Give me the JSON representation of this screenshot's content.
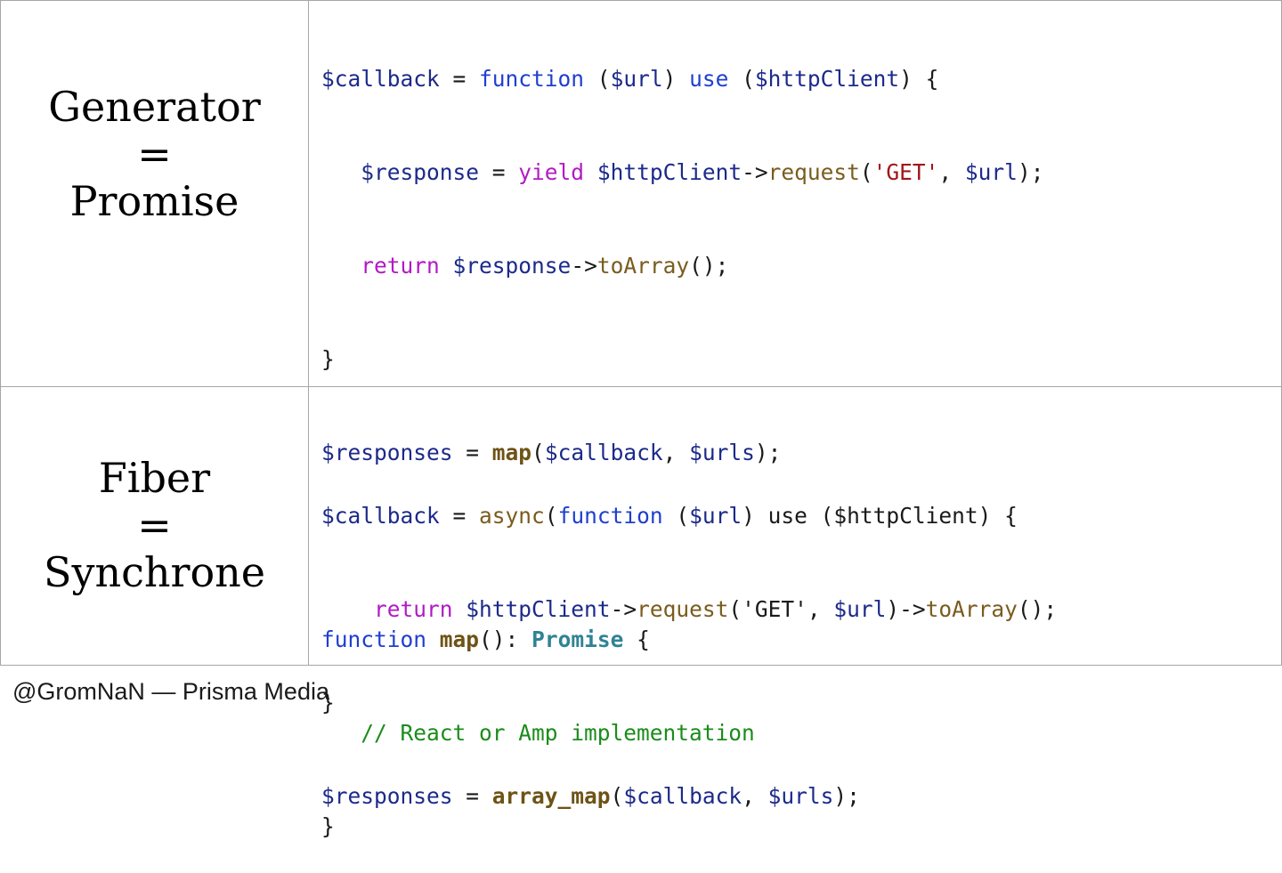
{
  "rows": [
    {
      "label_lines": [
        "Generator",
        "=",
        "Promise"
      ]
    },
    {
      "label_lines": [
        "Fiber",
        "=",
        "Synchrone"
      ]
    }
  ],
  "code_top": {
    "l1": {
      "a": "$callback",
      "b": " = ",
      "c": "function",
      "d": " (",
      "e": "$url",
      "f": ") ",
      "g": "use",
      "h": " (",
      "i": "$httpClient",
      "j": ") {"
    },
    "l2": {
      "indent": "   ",
      "a": "$response",
      "b": " = ",
      "c": "yield",
      "d": " ",
      "e": "$httpClient",
      "f": "->",
      "g": "request",
      "h": "(",
      "i": "'GET'",
      "j": ", ",
      "k": "$url",
      "l": ");"
    },
    "l3": {
      "indent": "   ",
      "a": "return",
      "b": " ",
      "c": "$response",
      "d": "->",
      "e": "toArray",
      "f": "();"
    },
    "l4": {
      "a": "}"
    },
    "l5": {
      "a": "$responses",
      "b": " = ",
      "c": "map",
      "d": "(",
      "e": "$callback",
      "f": ", ",
      "g": "$urls",
      "h": ");"
    },
    "l6": {
      "a": ""
    },
    "l7": {
      "a": "function",
      "b": " ",
      "c": "map",
      "d": "(): ",
      "e": "Promise",
      "f": " {"
    },
    "l8": {
      "indent": "   ",
      "a": "// React or Amp implementation"
    },
    "l9": {
      "a": "}"
    }
  },
  "code_bot": {
    "l1": {
      "a": "$callback",
      "b": " = ",
      "c": "async",
      "d": "(",
      "e": "function",
      "f": " (",
      "g": "$url",
      "h": ") use (",
      "i": "$httpClient",
      "j": ") {"
    },
    "l2": {
      "indent": "    ",
      "a": "return",
      "b": " ",
      "c": "$httpClient",
      "d": "->",
      "e": "request",
      "f": "('GET', ",
      "g": "$url",
      "h": ")->",
      "i": "toArray",
      "j": "();"
    },
    "l3": {
      "a": "}"
    },
    "l4": {
      "a": "$responses",
      "b": " = ",
      "c": "array_map",
      "d": "(",
      "e": "$callback",
      "f": ", ",
      "g": "$urls",
      "h": ");"
    }
  },
  "footer": "@GromNaN — Prisma Media"
}
